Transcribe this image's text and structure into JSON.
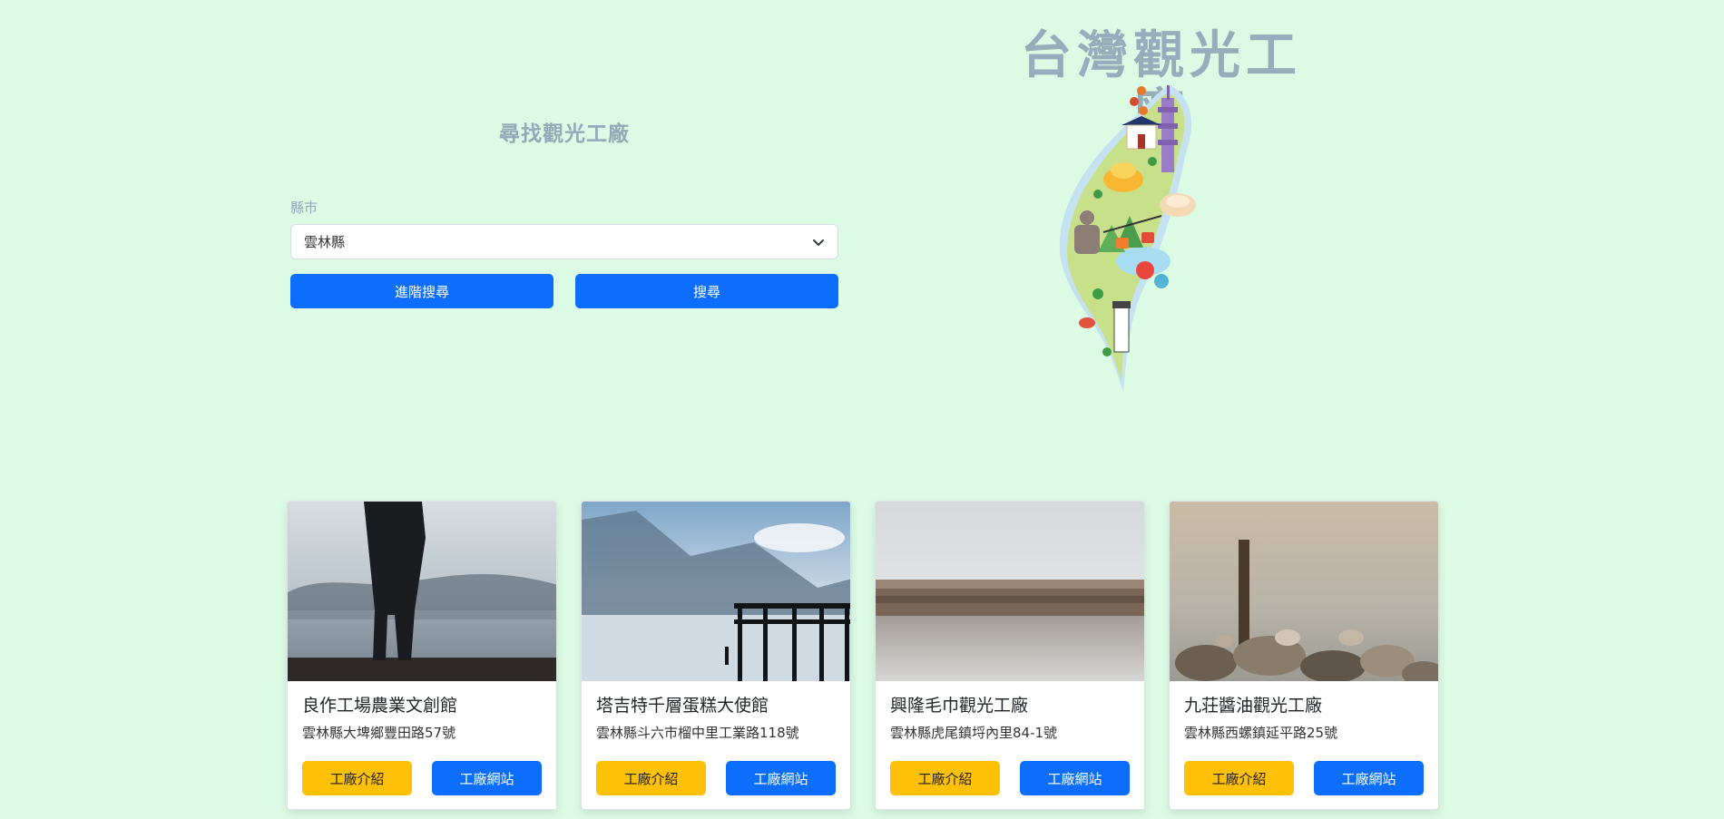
{
  "hero": {
    "title": "台灣觀光工廠",
    "map_icon": "taiwan-illustrated-map"
  },
  "search": {
    "heading": "尋找觀光工廠",
    "county_label": "縣市",
    "county_value": "雲林縣",
    "advanced_button": "進階搜尋",
    "search_button": "搜尋"
  },
  "cards": [
    {
      "title": "良作工場農業文創館",
      "address": "雲林縣大埤鄉豐田路57號",
      "intro_button": "工廠介紹",
      "site_button": "工廠網站"
    },
    {
      "title": "塔吉特千層蛋糕大使館",
      "address": "雲林縣斗六市榴中里工業路118號",
      "intro_button": "工廠介紹",
      "site_button": "工廠網站"
    },
    {
      "title": "興隆毛巾觀光工廠",
      "address": "雲林縣虎尾鎮埒內里84-1號",
      "intro_button": "工廠介紹",
      "site_button": "工廠網站"
    },
    {
      "title": "九荘醬油觀光工廠",
      "address": "雲林縣西螺鎮延平路25號",
      "intro_button": "工廠介紹",
      "site_button": "工廠網站"
    }
  ],
  "colors": {
    "background": "#dbfbe4",
    "primary": "#0d6efd",
    "warning": "#ffc107",
    "heading": "#92aab8"
  }
}
